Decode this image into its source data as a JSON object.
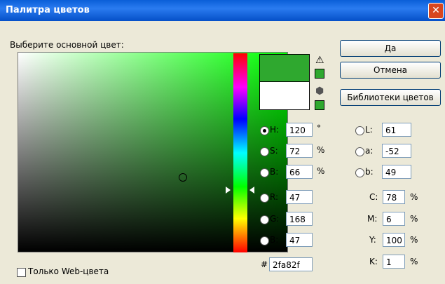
{
  "window": {
    "title": "Палитра цветов",
    "close_glyph": "✕"
  },
  "prompt": "Выберите основной цвет:",
  "colors": {
    "new_color": "#2fa82f",
    "old_color": "#ffffff"
  },
  "buttons": {
    "ok": "Да",
    "cancel": "Отмена",
    "libraries": "Библиотеки цветов"
  },
  "icons": {
    "gamut_warning": "⚠",
    "web_safe": "⬢"
  },
  "hsb": {
    "h": {
      "label": "H:",
      "value": "120",
      "unit": "°"
    },
    "s": {
      "label": "S:",
      "value": "72",
      "unit": "%"
    },
    "b": {
      "label": "B:",
      "value": "66",
      "unit": "%"
    }
  },
  "rgb": {
    "r": {
      "label": "R:",
      "value": "47"
    },
    "g": {
      "label": "G:",
      "value": "168"
    },
    "b": {
      "label": "B:",
      "value": "47"
    }
  },
  "lab": {
    "l": {
      "label": "L:",
      "value": "61"
    },
    "a": {
      "label": "a:",
      "value": "-52"
    },
    "b": {
      "label": "b:",
      "value": "49"
    }
  },
  "cmyk": {
    "c": {
      "label": "C:",
      "value": "78",
      "unit": "%"
    },
    "m": {
      "label": "M:",
      "value": "6",
      "unit": "%"
    },
    "y": {
      "label": "Y:",
      "value": "100",
      "unit": "%"
    },
    "k": {
      "label": "K:",
      "value": "1",
      "unit": "%"
    }
  },
  "hex": {
    "label": "#",
    "value": "2fa82f"
  },
  "web_only": {
    "label": "Только Web-цвета"
  }
}
